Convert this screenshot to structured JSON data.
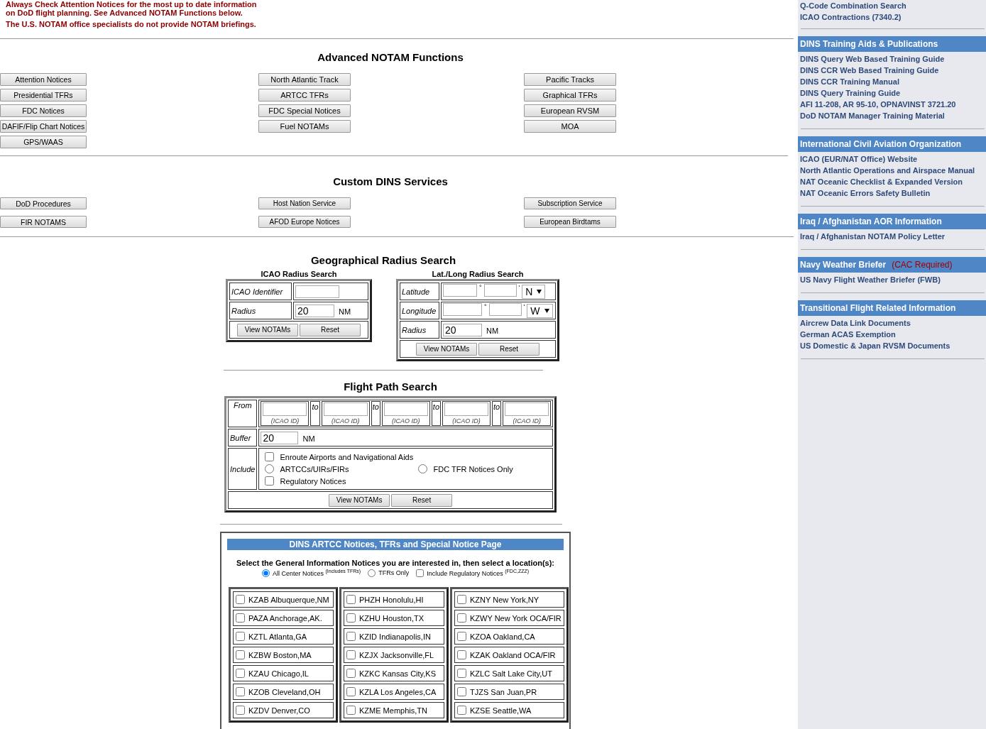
{
  "notices": [
    "Always Check Attention Notices for the most up to date information on DoD flight planning. See Advanced NOTAM Functions below.",
    "The U.S. NOTAM office specialists do not provide NOTAM briefings."
  ],
  "advanced": {
    "title": "Advanced NOTAM Functions",
    "columns": [
      [
        "Attention Notices",
        "Presidential TFRs",
        "FDC Notices",
        "DAFIF/Flip Chart Notices",
        "GPS/WAAS"
      ],
      [
        "North Atlantic Track",
        "ARTCC TFRs",
        "FDC Special Notices",
        "Fuel NOTAMs"
      ],
      [
        "Pacific Tracks",
        "Graphical TFRs",
        "European RVSM",
        "MOA"
      ]
    ]
  },
  "custom": {
    "title": "Custom DINS Services",
    "columns": [
      [
        "DoD Procedures",
        "FIR NOTAMS"
      ],
      [
        "Host Nation Service",
        "AFOD Europe Notices"
      ],
      [
        "Subscription Service",
        "European Birdtams"
      ]
    ]
  },
  "geo": {
    "title": "Geographical Radius Search",
    "icao": {
      "title": "ICAO Radius Search",
      "identifier_label": "ICAO Identifier",
      "radius_label": "Radius",
      "radius_value": "20",
      "unit": "NM",
      "buttons": [
        "View NOTAMs",
        "Reset"
      ]
    },
    "latlong": {
      "title": "Lat./Long Radius Search",
      "latitude_label": "Latitude",
      "lat_hemisphere": "N",
      "longitude_label": "Longitude",
      "lon_hemisphere": "W",
      "degree_mark": "°",
      "minute_mark": "'",
      "radius_label": "Radius",
      "radius_value": "20",
      "unit": "NM",
      "buttons": [
        "View NOTAMs",
        "Reset"
      ]
    }
  },
  "flight_path": {
    "title": "Flight Path Search",
    "from_label": "From",
    "to_labels": [
      "to",
      "to",
      "to",
      "to"
    ],
    "waypoint_hints": [
      "(ICAO ID)",
      "(ICAO ID)",
      "(ICAO ID)",
      "(ICAO ID)",
      "(ICAO ID)"
    ],
    "buffer_label": "Buffer",
    "buffer_value": "20",
    "unit": "NM",
    "include_label": "Include",
    "options": [
      {
        "kind": "checkbox",
        "label": "Enroute Airports and Navigational Aids",
        "checked": false
      },
      {
        "kind": "radio",
        "label": "ARTCCs/UIRs/FIRs",
        "selected": false
      },
      {
        "kind": "radio",
        "label": "FDC TFR Notices Only",
        "selected": false
      },
      {
        "kind": "checkbox",
        "label": "Regulatory Notices",
        "checked": false
      }
    ],
    "buttons": [
      "View NOTAMs",
      "Reset"
    ]
  },
  "artcc": {
    "title": "DINS ARTCC Notices, TFRs and Special Notice Page",
    "prompt": "Select the General Information Notices you are interested in, then select a location(s):",
    "modes": [
      {
        "kind": "radio",
        "label": "All Center Notices",
        "note": "(Includes TFRs)",
        "selected": true
      },
      {
        "kind": "radio",
        "label": "TFRs Only",
        "selected": false
      },
      {
        "kind": "checkbox",
        "label": "Include Regulatory Notices",
        "note": "(FDC,ZZZ)",
        "checked": false
      }
    ],
    "columns": [
      [
        {
          "label": "KZAB Albuquerque,NM",
          "checked": false
        },
        {
          "label": "PAZA Anchorage,AK.",
          "checked": false
        },
        {
          "label": "KZTL Atlanta,GA",
          "checked": false
        },
        {
          "label": "KZBW Boston,MA",
          "checked": false
        },
        {
          "label": "KZAU Chicago,IL",
          "checked": false
        },
        {
          "label": "KZOB Cleveland,OH",
          "checked": false
        },
        {
          "label": "KZDV Denver,CO",
          "checked": false
        }
      ],
      [
        {
          "label": "PHZH Honolulu,HI",
          "checked": false
        },
        {
          "label": "KZHU Houston,TX",
          "checked": false
        },
        {
          "label": "KZID Indianapolis,IN",
          "checked": false
        },
        {
          "label": "KZJX Jacksonville,FL",
          "checked": false
        },
        {
          "label": "KZKC Kansas City,KS",
          "checked": false
        },
        {
          "label": "KZLA Los Angeles,CA",
          "checked": false
        },
        {
          "label": "KZME Memphis,TN",
          "checked": false
        }
      ],
      [
        {
          "label": "KZNY New York,NY",
          "checked": false
        },
        {
          "label": "KZWY New York OCA/FIR",
          "checked": false
        },
        {
          "label": "KZOA Oakland,CA",
          "checked": false
        },
        {
          "label": "KZAK Oakland OCA/FIR",
          "checked": false
        },
        {
          "label": "KZLC Salt Lake City,UT",
          "checked": false
        },
        {
          "label": "TJZS San Juan,PR",
          "checked": false
        },
        {
          "label": "KZSE Seattle,WA",
          "checked": false
        }
      ]
    ]
  },
  "sidebar": {
    "top_links": [
      "Q-Code Combination Search",
      "ICAO Contractions (7340.2)"
    ],
    "sections": [
      {
        "title": "DINS Training Aids & Publications",
        "links": [
          "DINS Query Web Based Training Guide",
          "DINS CCR Web Based Training Guide",
          "DINS CCR Training Manual",
          "DINS Query Training Guide",
          "AFI 11-208, AR 95-10, OPNAVINST 3721.20",
          "DoD NOTAM Manager Training Material"
        ]
      },
      {
        "title": "International Civil Aviation Organization",
        "links": [
          "ICAO (EUR/NAT Office) Website",
          "North Atlantic Operations and Airspace Manual",
          "NAT Oceanic Checklist & Expanded Version",
          "NAT Oceanic Errors Safety Bulletin"
        ]
      },
      {
        "title": "Iraq / Afghanistan AOR Information",
        "links": [
          "Iraq / Afghanistan NOTAM Policy Letter"
        ]
      },
      {
        "title": "Navy Weather Briefer",
        "note": "(CAC Required)",
        "links": [
          "US Navy Flight Weather Briefer (FWB)"
        ]
      },
      {
        "title": "Transitional Flight Related Information",
        "links": [
          "Aircrew Data Link Documents",
          "German ACAS Exemption",
          "US Domestic & Japan RVSM Documents"
        ]
      }
    ]
  }
}
